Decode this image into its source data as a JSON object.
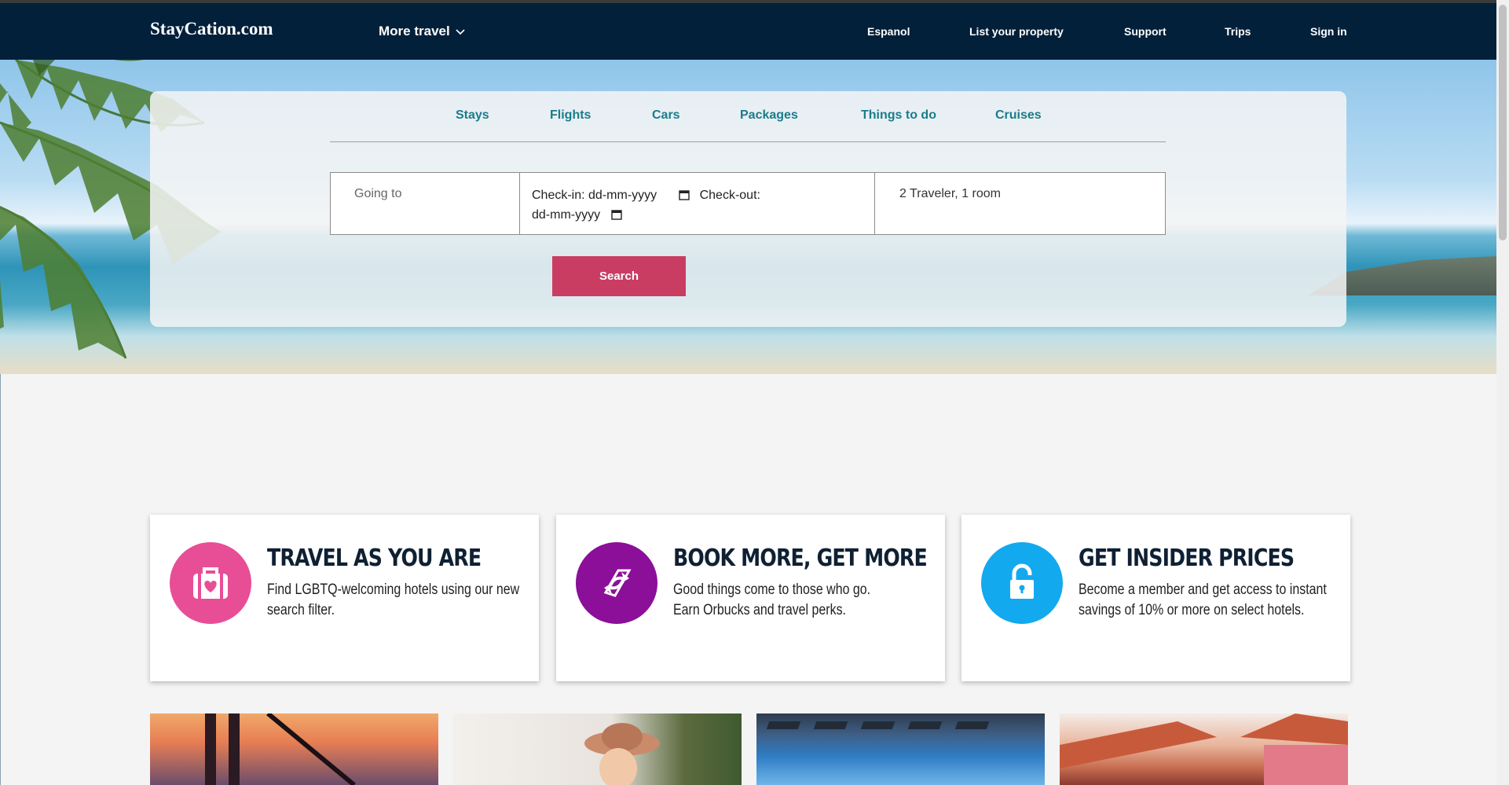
{
  "brand": "StayCation.com",
  "nav": {
    "more_travel": "More travel",
    "links": [
      "Espanol",
      "List your property",
      "Support",
      "Trips",
      "Sign in"
    ]
  },
  "search": {
    "tabs": [
      "Stays",
      "Flights",
      "Cars",
      "Packages",
      "Things to do",
      "Cruises"
    ],
    "going_to_placeholder": "Going to",
    "checkin_label": "Check-in:",
    "checkin_value": "dd-mm-yyyy",
    "checkout_label": "Check-out:",
    "checkout_value": "dd-mm-yyyy",
    "travelers": "2 Traveler, 1 room",
    "button": "Search"
  },
  "promos": [
    {
      "title": "TRAVEL AS YOU ARE",
      "text": "Find LGBTQ-welcoming hotels using our new search filter.",
      "icon": "suitcase-heart-icon",
      "color": "#e84e95"
    },
    {
      "title": "BOOK MORE, GET MORE",
      "text_line1": "Good things come to those who go.",
      "text_line2": "Earn Orbucks and travel perks.",
      "icon": "exchange-arrows-icon",
      "color": "#8b0f98"
    },
    {
      "title": "GET INSIDER PRICES",
      "text": "Become a member and get access to instant savings of 10% or more on select hotels.",
      "icon": "unlock-icon",
      "color": "#12a9ef"
    }
  ],
  "colors": {
    "navbar": "#03203a",
    "tab_text": "#1b7c8a",
    "search_button": "#c93d63"
  }
}
